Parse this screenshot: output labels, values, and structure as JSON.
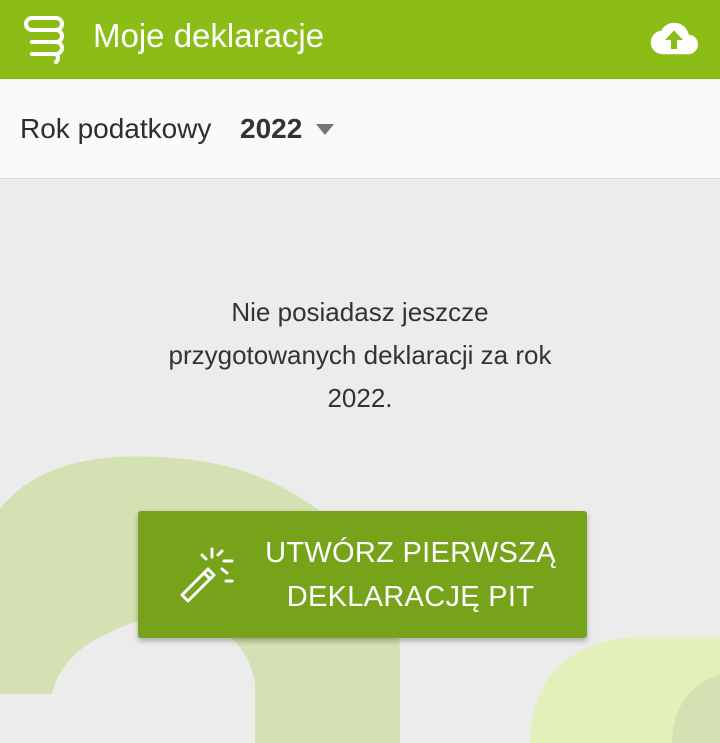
{
  "appbar": {
    "menu_icon": "stack-menu-icon",
    "title": "Moje deklaracje",
    "cloud_icon": "cloud-upload-icon",
    "background": "#8cbd17"
  },
  "year_filter": {
    "label": "Rok podatkowy",
    "selected_year": "2022",
    "caret_icon": "dropdown-caret-icon"
  },
  "empty_state": {
    "line1": "Nie posiadasz jeszcze",
    "line2": "przygotowanych deklaracji za rok",
    "line3": "2022."
  },
  "cta": {
    "line1": "UTWÓRZ PIERWSZĄ",
    "line2": "DEKLARACJĘ PIT",
    "icon": "magic-wand-icon",
    "background": "#76a31a"
  },
  "colors": {
    "content_background": "#ececec",
    "decoration_light_green": "#d3e1b3",
    "decoration_lime": "#e4f0b9"
  }
}
